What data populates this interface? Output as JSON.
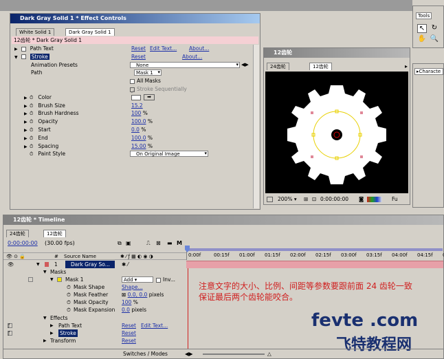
{
  "effect_controls": {
    "title": "Dark Gray Solid 1 * Effect Controls",
    "tabs": [
      "White Solid 1",
      "Dark Gray Solid 1"
    ],
    "breadcrumb": "12齿轮 * Dark Gray Solid 1",
    "rows": {
      "path_text": {
        "label": "Path Text",
        "reset": "Reset",
        "edit": "Edit Text...",
        "about": "About..."
      },
      "stroke": {
        "label": "Stroke",
        "reset": "Reset",
        "about": "About..."
      },
      "animation_presets": {
        "label": "Animation Presets",
        "value": "None"
      },
      "path": {
        "label": "Path",
        "value": "Mask 1"
      },
      "all_masks": {
        "label": "All Masks"
      },
      "stroke_seq": {
        "label": "Stroke Sequentially"
      },
      "color": {
        "label": "Color"
      },
      "brush_size": {
        "label": "Brush Size",
        "value": "15.2"
      },
      "brush_hardness": {
        "label": "Brush Hardness",
        "value": "100",
        "unit": "%"
      },
      "opacity": {
        "label": "Opacity",
        "value": "100.0",
        "unit": "%"
      },
      "start": {
        "label": "Start",
        "value": "0.0",
        "unit": "%"
      },
      "end": {
        "label": "End",
        "value": "100.0",
        "unit": "%"
      },
      "spacing": {
        "label": "Spacing",
        "value": "15.00",
        "unit": "%"
      },
      "paint_style": {
        "label": "Paint Style",
        "value": "On Original Image"
      }
    }
  },
  "comp_window": {
    "title": "12齿轮",
    "tabs": [
      "24齿轮",
      "12齿轮"
    ],
    "zoom": "200%",
    "timecode": "0:00:00:00",
    "extra": "Fu"
  },
  "tools": {
    "title": "Tools",
    "char_tab": "Characte"
  },
  "timeline": {
    "title": "12齿轮 * Timeline",
    "tabs": [
      "24齿轮",
      "12齿轮"
    ],
    "timecode": "0:00:00:00",
    "fps": "(30.00 fps)",
    "col_num": "#",
    "col_source": "Source Name",
    "ruler": [
      "0:00f",
      "00:15f",
      "01:00f",
      "01:15f",
      "02:00f",
      "02:15f",
      "03:00f",
      "03:15f",
      "04:00f",
      "04:15f",
      "05:0"
    ],
    "layer": {
      "num": "1",
      "name": "Dark Gray So..."
    },
    "masks": "Masks",
    "mask1": "Mask 1",
    "mask_mode": "Add",
    "inv": "Inv...",
    "mask_shape": {
      "label": "Mask Shape",
      "value": "Shape..."
    },
    "mask_feather": {
      "label": "Mask Feather",
      "value": "0.0, 0.0",
      "unit": "pixels"
    },
    "mask_opacity": {
      "label": "Mask Opacity",
      "value": "100",
      "unit": "%"
    },
    "mask_expansion": {
      "label": "Mask Expansion",
      "value": "0.0",
      "unit": "pixels"
    },
    "effects": "Effects",
    "path_text": {
      "label": "Path Text",
      "reset": "Reset",
      "edit": "Edit Text..."
    },
    "stroke": {
      "label": "Stroke",
      "reset": "Reset"
    },
    "transform": {
      "label": "Transform",
      "reset": "Reset"
    },
    "switches": "Switches / Modes"
  },
  "annotation": {
    "line1": "注意文字的大小、比例、间距等参数要跟前面 24 齿轮一致",
    "line2": "保证最后两个齿轮能咬合。"
  },
  "watermark": {
    "site": "fevte .com",
    "cn": "飞特教程网"
  }
}
